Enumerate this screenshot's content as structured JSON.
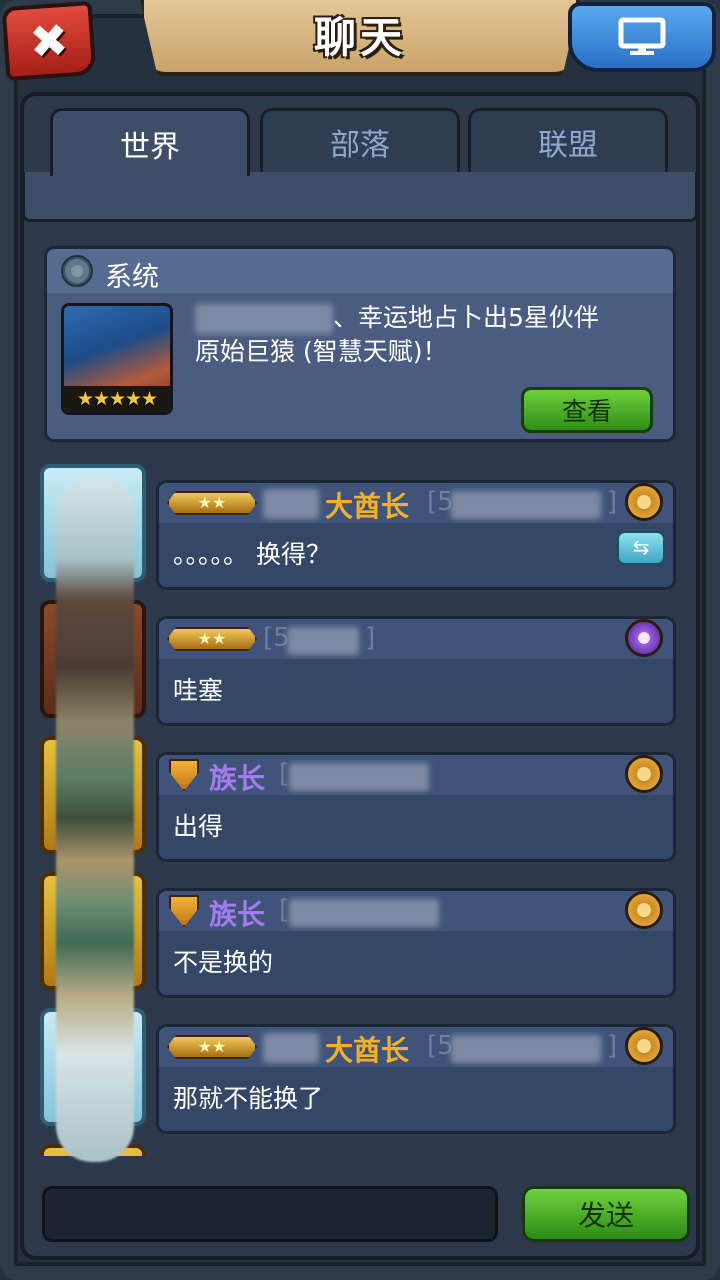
{
  "header": {
    "title": "聊天",
    "close_icon": "close-icon",
    "screen_icon": "monitor-icon"
  },
  "tabs": [
    {
      "label": "世界",
      "active": true
    },
    {
      "label": "部落",
      "active": false
    },
    {
      "label": "联盟",
      "active": false
    }
  ],
  "system": {
    "label": "系统",
    "message_line1": "、幸运地占卜出5星伙伴",
    "message_line2": "原始巨猿 (智慧天赋)！",
    "portrait_stars": "★★★★★",
    "view_label": "查看"
  },
  "messages": [
    {
      "rank_stars": "★★",
      "name": "大酋长",
      "name_color": "gold",
      "bracket": "[5",
      "bracket_end": "]",
      "text": "。。。。。 换得？",
      "badge": "orange",
      "has_swap": true
    },
    {
      "rank_stars": "★★",
      "name": "",
      "name_color": "gold",
      "bracket": "[5",
      "bracket_end": "]",
      "text": "哇塞",
      "badge": "purple",
      "has_swap": false
    },
    {
      "rank_stars": "",
      "name": "族长",
      "name_color": "purple",
      "bracket": "[",
      "bracket_end": "",
      "text": "出得",
      "badge": "orange",
      "has_swap": false
    },
    {
      "rank_stars": "",
      "name": "族长",
      "name_color": "purple",
      "bracket": "[",
      "bracket_end": "",
      "text": "不是换的",
      "badge": "orange",
      "has_swap": false
    },
    {
      "rank_stars": "★★",
      "name": "大酋长",
      "name_color": "gold",
      "bracket": "[5",
      "bracket_end": "]",
      "text": "那就不能换了",
      "badge": "orange",
      "has_swap": false
    }
  ],
  "footer": {
    "input_value": "",
    "send_label": "发送"
  }
}
